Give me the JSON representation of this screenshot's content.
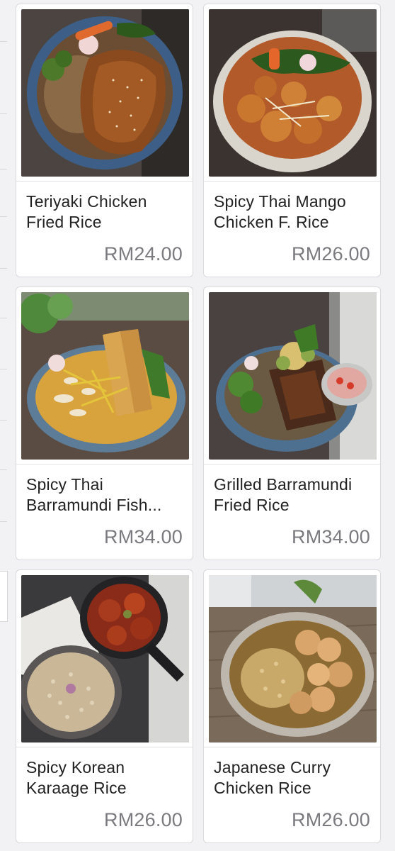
{
  "menu": {
    "items": [
      {
        "name": "Teriyaki Chicken Fried Rice",
        "price": "RM24.00",
        "image": "teriyaki-chicken-fried-rice-photo"
      },
      {
        "name": "Spicy Thai Mango Chicken F. Rice",
        "price": "RM26.00",
        "image": "spicy-thai-mango-chicken-photo"
      },
      {
        "name": "Spicy Thai Barramundi Fish...",
        "price": "RM34.00",
        "image": "spicy-thai-barramundi-photo"
      },
      {
        "name": "Grilled Barramundi Fried Rice",
        "price": "RM34.00",
        "image": "grilled-barramundi-photo"
      },
      {
        "name": "Spicy Korean Karaage Rice",
        "price": "RM26.00",
        "image": "spicy-korean-karaage-photo"
      },
      {
        "name": "Japanese Curry Chicken Rice",
        "price": "RM26.00",
        "image": "japanese-curry-chicken-photo"
      }
    ]
  },
  "colors": {
    "price_text": "#7b7b7f",
    "name_text": "#222222",
    "card_border": "#d9d9de"
  }
}
